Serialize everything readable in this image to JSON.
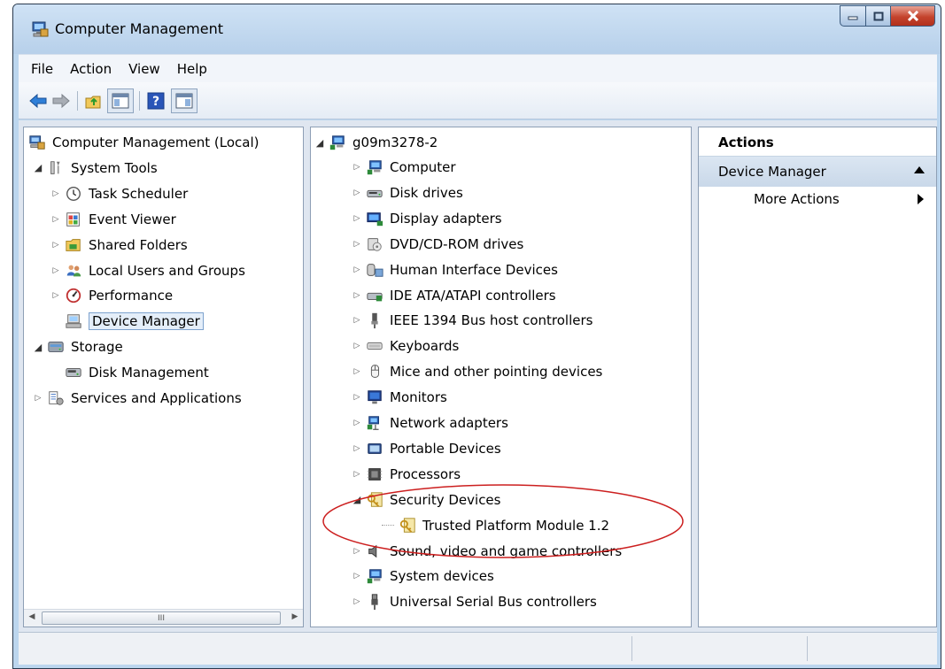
{
  "window": {
    "title": "Computer Management",
    "icon": "computer-management-icon",
    "controls": [
      "minimize",
      "maximize",
      "close"
    ]
  },
  "menu": [
    "File",
    "Action",
    "View",
    "Help"
  ],
  "toolbar": {
    "buttons": [
      "back-icon",
      "forward-icon",
      "up-folder-icon",
      "show-hide-console-tree-icon",
      "help-icon",
      "show-hide-action-pane-icon"
    ]
  },
  "left_tree": [
    {
      "label": "Computer Management (Local)",
      "icon": "computer-management-icon",
      "expander": "none"
    },
    {
      "label": "System Tools",
      "icon": "system-tools-icon",
      "expander": "expanded"
    },
    {
      "label": "Task Scheduler",
      "icon": "clock-icon",
      "expander": "collapsed"
    },
    {
      "label": "Event Viewer",
      "icon": "event-viewer-icon",
      "expander": "collapsed"
    },
    {
      "label": "Shared Folders",
      "icon": "shared-folder-icon",
      "expander": "collapsed"
    },
    {
      "label": "Local Users and Groups",
      "icon": "users-icon",
      "expander": "collapsed"
    },
    {
      "label": "Performance",
      "icon": "performance-icon",
      "expander": "collapsed"
    },
    {
      "label": "Device Manager",
      "icon": "device-manager-icon",
      "expander": "none",
      "selected": true
    },
    {
      "label": "Storage",
      "icon": "storage-icon",
      "expander": "expanded"
    },
    {
      "label": "Disk Management",
      "icon": "disk-management-icon",
      "expander": "none"
    },
    {
      "label": "Services and Applications",
      "icon": "services-icon",
      "expander": "collapsed"
    }
  ],
  "device_tree": {
    "root": {
      "label": "g09m3278-2",
      "icon": "computer-icon"
    },
    "items": [
      {
        "label": "Computer",
        "icon": "computer-icon",
        "expander": "collapsed"
      },
      {
        "label": "Disk drives",
        "icon": "disk-drive-icon",
        "expander": "collapsed"
      },
      {
        "label": "Display adapters",
        "icon": "display-adapter-icon",
        "expander": "collapsed"
      },
      {
        "label": "DVD/CD-ROM drives",
        "icon": "dvd-drive-icon",
        "expander": "collapsed"
      },
      {
        "label": "Human Interface Devices",
        "icon": "hid-icon",
        "expander": "collapsed"
      },
      {
        "label": "IDE ATA/ATAPI controllers",
        "icon": "ide-controller-icon",
        "expander": "collapsed"
      },
      {
        "label": "IEEE 1394 Bus host controllers",
        "icon": "ieee1394-icon",
        "expander": "collapsed"
      },
      {
        "label": "Keyboards",
        "icon": "keyboard-icon",
        "expander": "collapsed"
      },
      {
        "label": "Mice and other pointing devices",
        "icon": "mouse-icon",
        "expander": "collapsed"
      },
      {
        "label": "Monitors",
        "icon": "monitor-icon",
        "expander": "collapsed"
      },
      {
        "label": "Network adapters",
        "icon": "network-adapter-icon",
        "expander": "collapsed"
      },
      {
        "label": "Portable Devices",
        "icon": "portable-device-icon",
        "expander": "collapsed"
      },
      {
        "label": "Processors",
        "icon": "processor-icon",
        "expander": "collapsed"
      },
      {
        "label": "Security Devices",
        "icon": "security-key-icon",
        "expander": "expanded"
      },
      {
        "label": "Trusted Platform Module 1.2",
        "icon": "security-key-icon",
        "expander": "none",
        "child": true
      },
      {
        "label": "Sound, video and game controllers",
        "icon": "speaker-icon",
        "expander": "collapsed"
      },
      {
        "label": "System devices",
        "icon": "computer-icon",
        "expander": "collapsed"
      },
      {
        "label": "Universal Serial Bus controllers",
        "icon": "usb-icon",
        "expander": "collapsed"
      }
    ]
  },
  "actions": {
    "header": "Actions",
    "section": "Device Manager",
    "items": [
      "More Actions"
    ]
  },
  "scrollbar_glyph": "III",
  "colors": {
    "highlight_ellipse": "#cc1f1f",
    "selection_border": "#7da2ce",
    "window_frame": "#bcd6ee"
  }
}
